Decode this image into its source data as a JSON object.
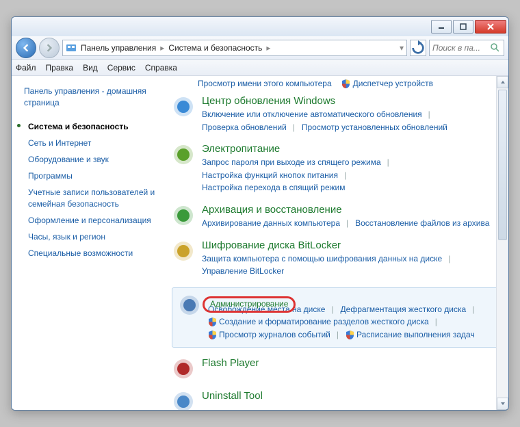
{
  "titlebar": {
    "minimize": "—",
    "maximize": "▢",
    "close": "✕"
  },
  "breadcrumb": {
    "root": "Панель управления",
    "current": "Система и безопасность"
  },
  "search": {
    "placeholder": "Поиск в па..."
  },
  "menu": {
    "file": "Файл",
    "edit": "Правка",
    "view": "Вид",
    "tools": "Сервис",
    "help": "Справка"
  },
  "sidebar": {
    "home": "Панель управления - домашняя страница",
    "items": [
      {
        "label": "Система и безопасность",
        "active": true
      },
      {
        "label": "Сеть и Интернет"
      },
      {
        "label": "Оборудование и звук"
      },
      {
        "label": "Программы"
      },
      {
        "label": "Учетные записи пользователей и семейная безопасность"
      },
      {
        "label": "Оформление и персонализация"
      },
      {
        "label": "Часы, язык и регион"
      },
      {
        "label": "Специальные возможности"
      }
    ]
  },
  "topLinks": [
    {
      "label": "Просмотр имени этого компьютера"
    },
    {
      "label": "Диспетчер устройств",
      "shield": true
    }
  ],
  "categories": [
    {
      "title": "Центр обновления Windows",
      "iconColor": "#3a8ad6",
      "links": [
        {
          "label": "Включение или отключение автоматического обновления"
        },
        {
          "label": "Проверка обновлений"
        },
        {
          "label": "Просмотр установленных обновлений"
        }
      ]
    },
    {
      "title": "Электропитание",
      "iconColor": "#5aa02a",
      "links": [
        {
          "label": "Запрос пароля при выходе из спящего режима"
        },
        {
          "label": "Настройка функций кнопок питания"
        },
        {
          "label": "Настройка перехода в спящий режим"
        }
      ]
    },
    {
      "title": "Архивация и восстановление",
      "iconColor": "#3a9a3a",
      "links": [
        {
          "label": "Архивирование данных компьютера"
        },
        {
          "label": "Восстановление файлов из архива"
        }
      ]
    },
    {
      "title": "Шифрование диска BitLocker",
      "iconColor": "#caa22a",
      "links": [
        {
          "label": "Защита компьютера с помощью шифрования данных на диске"
        },
        {
          "label": "Управление BitLocker"
        }
      ]
    },
    {
      "title": "Администрирование",
      "highlight": true,
      "iconColor": "#4a7ab4",
      "links": [
        {
          "label": "Освобождение места на диске"
        },
        {
          "label": "Дефрагментация жесткого диска"
        },
        {
          "label": "Создание и форматирование разделов жесткого диска",
          "shield": true
        },
        {
          "label": "Просмотр журналов событий",
          "shield": true
        },
        {
          "label": "Расписание выполнения задач",
          "shield": true
        }
      ]
    },
    {
      "title": "Flash Player",
      "iconColor": "#b02a2a",
      "links": []
    },
    {
      "title": "Uninstall Tool",
      "iconColor": "#4a88c8",
      "links": []
    }
  ]
}
